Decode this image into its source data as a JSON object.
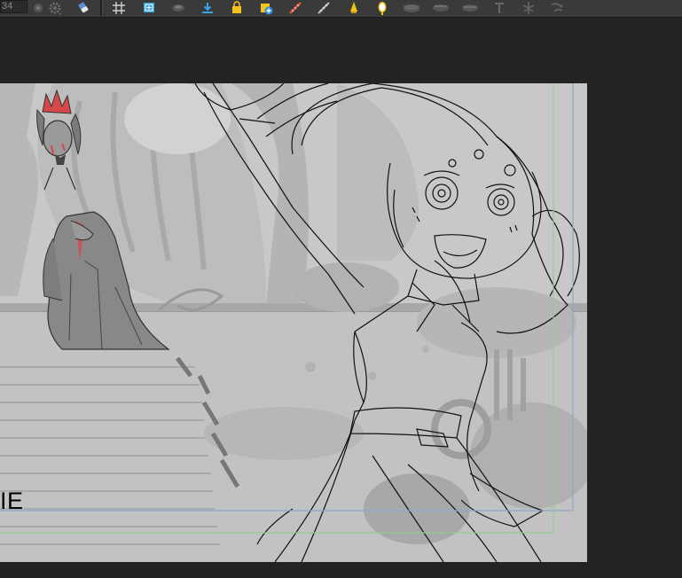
{
  "toolbar": {
    "frame_value": "34",
    "tools": [
      {
        "name": "onion-skin-icon"
      },
      {
        "name": "eraser-tool-icon"
      },
      {
        "name": "grid-icon"
      },
      {
        "name": "safe-area-icon"
      },
      {
        "name": "camera-mask-icon"
      },
      {
        "name": "import-icon"
      },
      {
        "name": "lock-icon"
      },
      {
        "name": "add-drawing-icon"
      },
      {
        "name": "ruler-icon"
      },
      {
        "name": "ruler-alt-icon"
      },
      {
        "name": "light-icon"
      },
      {
        "name": "mirror-icon"
      },
      {
        "name": "layer-stack-icon"
      },
      {
        "name": "layer-stack-down-icon"
      },
      {
        "name": "layer-stack-up-icon"
      },
      {
        "name": "pivot-icon"
      },
      {
        "name": "deform-icon"
      },
      {
        "name": "bone-icon"
      }
    ]
  },
  "canvas": {
    "label": "IE",
    "colors": {
      "background": "#232323",
      "stage": "#c9c9c9",
      "safe_frame_blue": "#8fa6c8",
      "title_safe_green": "#8fcf8f",
      "crown_red": "#d8474a"
    }
  }
}
